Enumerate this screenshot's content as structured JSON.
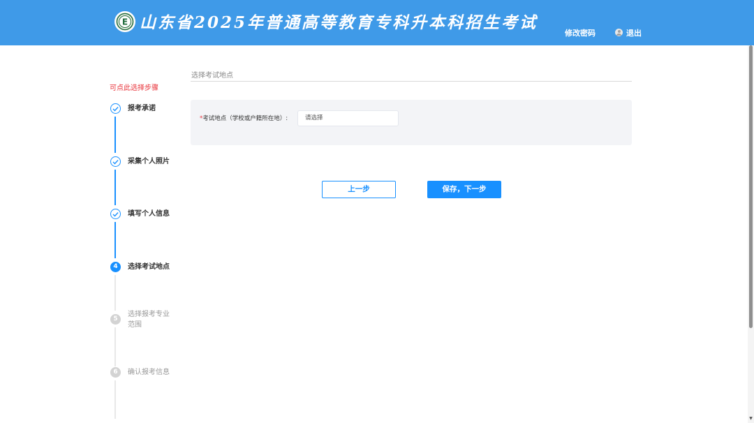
{
  "header": {
    "title": "山东省2025年普通高等教育专科升本科招生考试",
    "logo_letter": "E",
    "change_password": "修改密码",
    "logout": "退出"
  },
  "hint": "可点此选择步骤",
  "steps": [
    {
      "number": "1",
      "label": "报考承诺",
      "status": "done"
    },
    {
      "number": "2",
      "label": "采集个人照片",
      "status": "done"
    },
    {
      "number": "3",
      "label": "填写个人信息",
      "status": "done"
    },
    {
      "number": "4",
      "label": "选择考试地点",
      "status": "active"
    },
    {
      "number": "5",
      "label_line1": "选择报考专业",
      "label_line2": "范围",
      "status": "pending"
    },
    {
      "number": "6",
      "label": "确认报考信息",
      "status": "pending"
    }
  ],
  "section": {
    "title": "选择考试地点"
  },
  "form": {
    "required_mark": "*",
    "field_label": "考试地点（学校或户籍所在地）:",
    "select_placeholder": "请选择"
  },
  "buttons": {
    "prev": "上一步",
    "next": "保存，下一步"
  },
  "colors": {
    "header_bg": "#3f9ae8",
    "primary": "#1890ff",
    "hint": "#e8333a"
  }
}
